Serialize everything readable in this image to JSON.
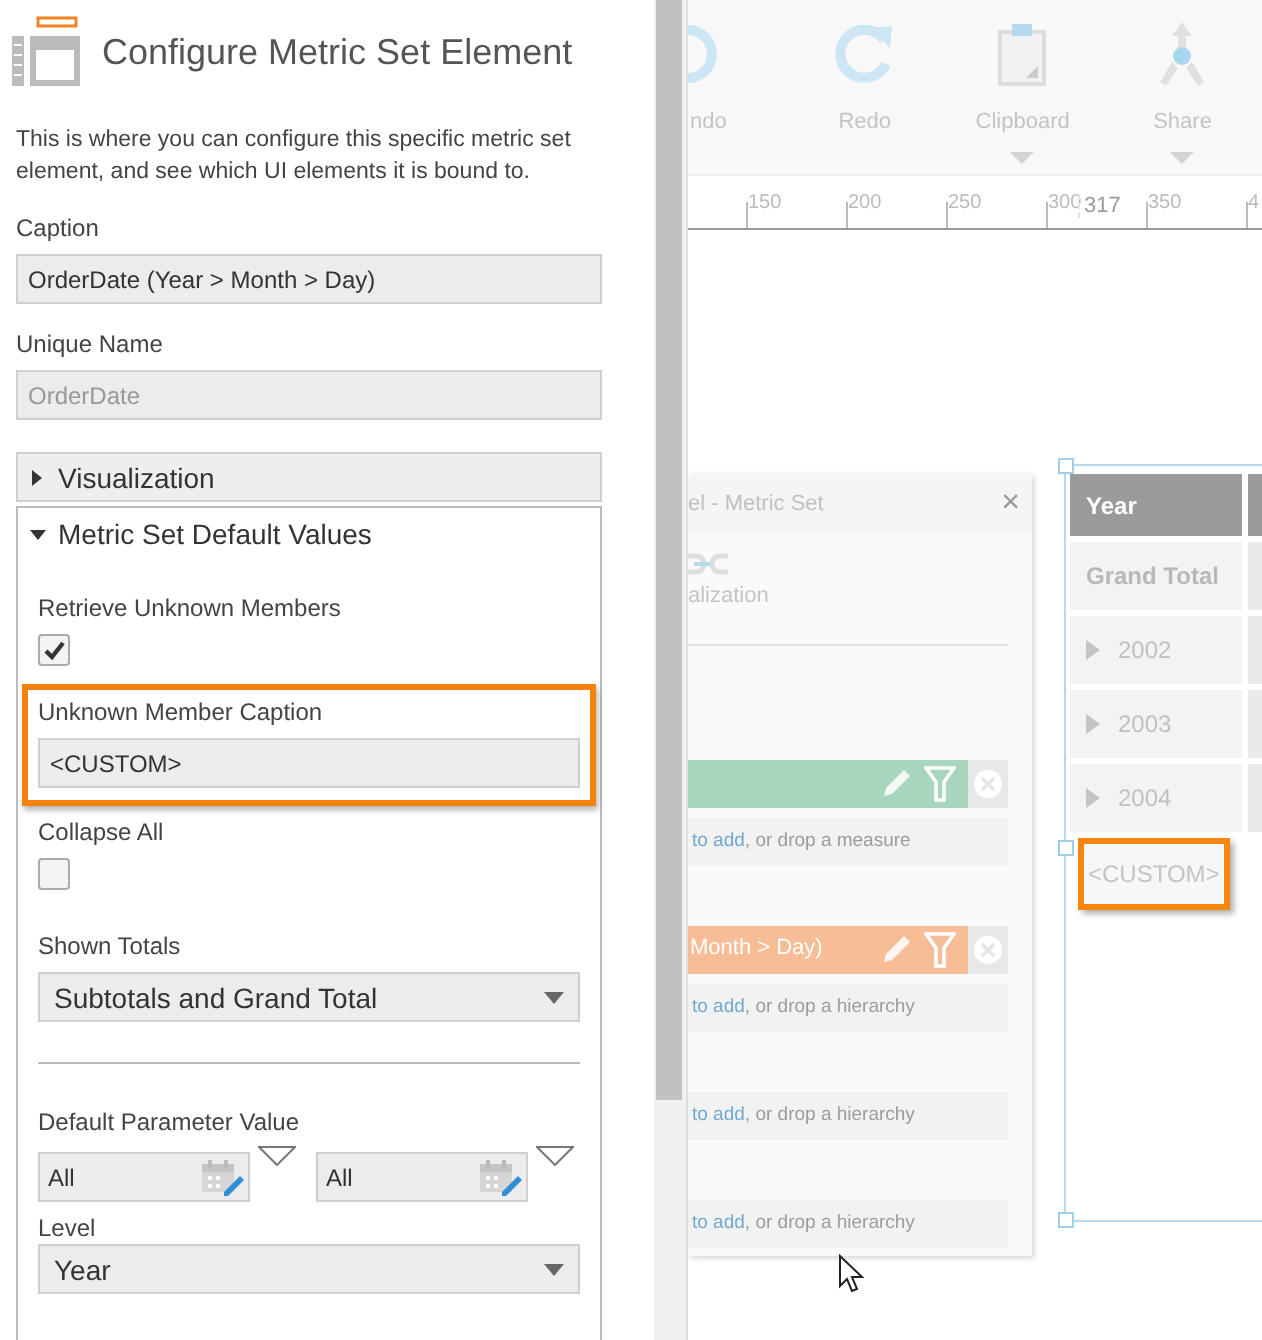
{
  "panel": {
    "title": "Configure Metric Set Element",
    "description": "This is where you can configure this specific metric set element, and see which UI elements it is bound to.",
    "fields": [
      {
        "label": "Caption",
        "value": "OrderDate (Year > Month > Day)",
        "disabled": false
      },
      {
        "label": "Unique Name",
        "value": "OrderDate",
        "disabled": true
      }
    ],
    "sections": [
      {
        "title": "Visualization",
        "expanded": false
      },
      {
        "title": "Metric Set Default Values",
        "expanded": true
      }
    ],
    "retrieve_unknown_members": {
      "label": "Retrieve Unknown Members",
      "checked": true
    },
    "unknown_member_caption": {
      "label": "Unknown Member Caption",
      "value": "<CUSTOM>",
      "highlighted": true
    },
    "collapse_all": {
      "label": "Collapse All",
      "checked": false
    },
    "shown_totals": {
      "label": "Shown Totals",
      "value": "Subtotals and Grand Total"
    },
    "default_parameter_value": {
      "label": "Default Parameter Value",
      "values": [
        "All",
        "All"
      ]
    },
    "level": {
      "label": "Level",
      "value": "Year"
    }
  },
  "toolbar": [
    {
      "kind": "undo",
      "label": "ndo",
      "dropdown": false
    },
    {
      "kind": "redo",
      "label": "Redo",
      "dropdown": false
    },
    {
      "kind": "clipboard",
      "label": "Clipboard",
      "dropdown": true
    },
    {
      "kind": "share",
      "label": "Share",
      "dropdown": true
    }
  ],
  "ruler": {
    "ticks": [
      "150",
      "200",
      "250",
      "300",
      "350",
      "4"
    ],
    "marker": "317"
  },
  "metric_set_panel": {
    "title": "el - Metric Set",
    "close": "×",
    "tab": "alization",
    "items": [
      {
        "kind": "bar",
        "color": "#a8d5bd"
      },
      {
        "kind": "drop",
        "link": "to add",
        "text": ", or drop a measure"
      },
      {
        "kind": "bar",
        "color": "#f6bd97",
        "label": "Month > Day)"
      },
      {
        "kind": "drop",
        "link": "to add",
        "text": ", or drop a hierarchy"
      },
      {
        "kind": "drop",
        "link": "to add",
        "text": ", or drop a hierarchy"
      },
      {
        "kind": "drop",
        "link": "to add",
        "text": ", or drop a hierarchy"
      }
    ]
  },
  "table": {
    "header": "Year",
    "rows": [
      {
        "kind": "total",
        "label": "Grand Total",
        "highlighted": false
      },
      {
        "kind": "member",
        "label": "2002",
        "highlighted": false
      },
      {
        "kind": "member",
        "label": "2003",
        "highlighted": false
      },
      {
        "kind": "member",
        "label": "2004",
        "highlighted": false
      },
      {
        "kind": "custom",
        "label": "<CUSTOM>",
        "highlighted": true
      }
    ]
  }
}
